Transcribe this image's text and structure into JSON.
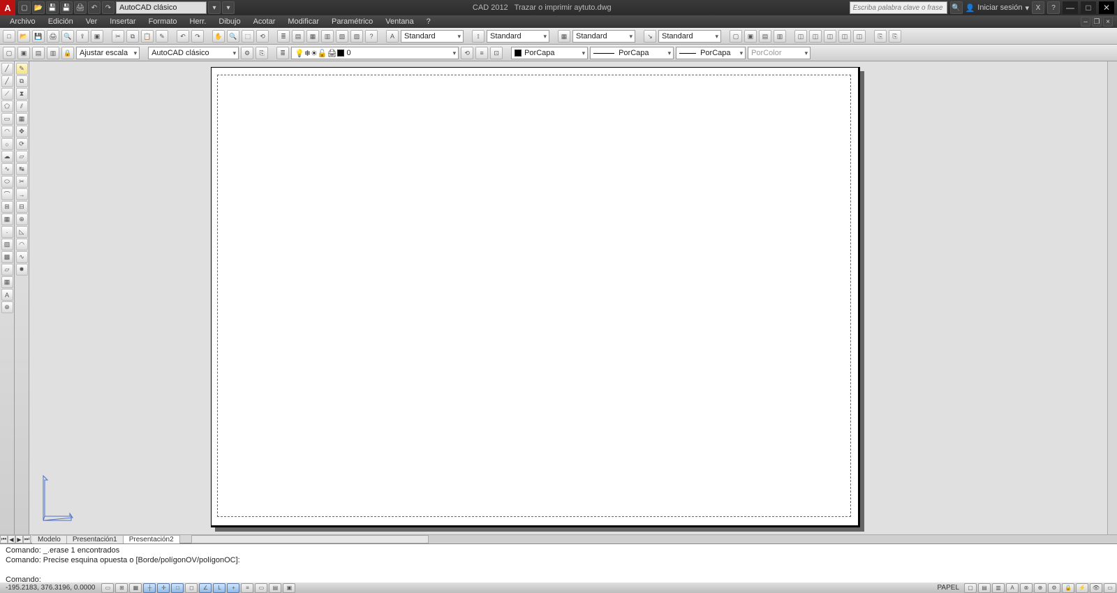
{
  "title": {
    "app": "CAD 2012",
    "doc": "Trazar o imprimir aytuto.dwg"
  },
  "workspace_selector": "AutoCAD clásico",
  "search_placeholder": "Escriba palabra clave o frase",
  "signin": "Iniciar sesión",
  "menu": [
    "Archivo",
    "Edición",
    "Ver",
    "Insertar",
    "Formato",
    "Herr.",
    "Dibujo",
    "Acotar",
    "Modificar",
    "Paramétrico",
    "Ventana",
    "?"
  ],
  "ribbon1": {
    "text_style": "Standard",
    "dim_style": "Standard",
    "table_style": "Standard",
    "mleader_style": "Standard"
  },
  "ribbon2": {
    "scale": "Ajustar escala",
    "workspace": "AutoCAD clásico",
    "layer": "0",
    "color": "PorCapa",
    "ltype": "PorCapa",
    "lweight": "PorCapa",
    "plotstyle": "PorColor"
  },
  "tabs": {
    "model": "Modelo",
    "layout1": "Presentación1",
    "layout2": "Presentación2"
  },
  "cmd": {
    "line1": "Comando: _.erase 1 encontrados",
    "line2": "Comando: Precise esquina opuesta o [Borde/polígonOV/polígonOC]:",
    "prompt": "Comando:"
  },
  "status": {
    "coords": "-195.2183, 376.3196, 0.0000",
    "space_label": "PAPEL"
  }
}
